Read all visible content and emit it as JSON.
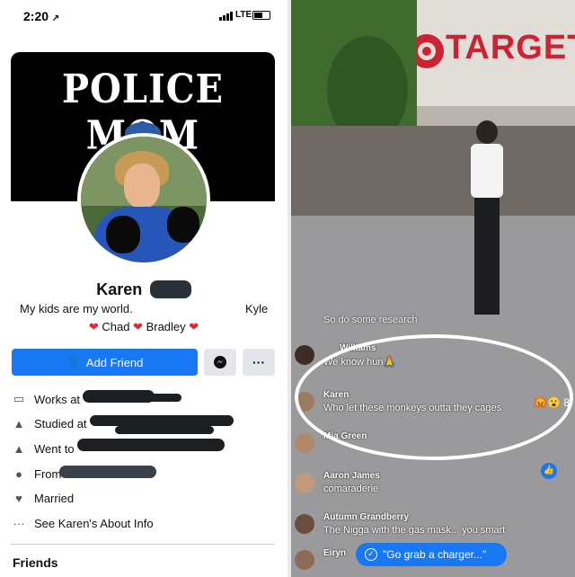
{
  "statusbar": {
    "time": "2:20",
    "arrow": "↗",
    "network": "LTE"
  },
  "cover": {
    "text": "POLICE MOM"
  },
  "profile": {
    "name": "Karen",
    "bio": "My kids are my world.",
    "bio_right": "Kyle",
    "family": [
      "Chad",
      "Bradley"
    ]
  },
  "actions": {
    "add_friend": "Add Friend",
    "more": "···"
  },
  "info": {
    "works": "Works at",
    "studied": "Studied at",
    "went": "Went to",
    "from": "From",
    "married": "Married",
    "about": "See Karen's About Info"
  },
  "friends_heading": "Friends",
  "store": {
    "sign": "TARGET"
  },
  "comments": [
    {
      "name": "",
      "text": "So do some research"
    },
    {
      "name": "Williams",
      "text": "We know hun🙏"
    },
    {
      "name": "Karen",
      "text": "Who let these monkeys outta they cages"
    },
    {
      "name": "Mia Green",
      "text": ""
    },
    {
      "name": "Aaron James",
      "text": "comaraderie"
    },
    {
      "name": "Autumn Grandberry",
      "text": "The Nigga with the gas mask... you smart"
    },
    {
      "name": "Eiryn",
      "text": ""
    }
  ],
  "reaction_count": "8",
  "live_pill": "\"Go grab a charger...\"",
  "colors": {
    "facebook_blue": "#1877f2",
    "target_red": "#cc2233",
    "heart": "#e0283a"
  }
}
